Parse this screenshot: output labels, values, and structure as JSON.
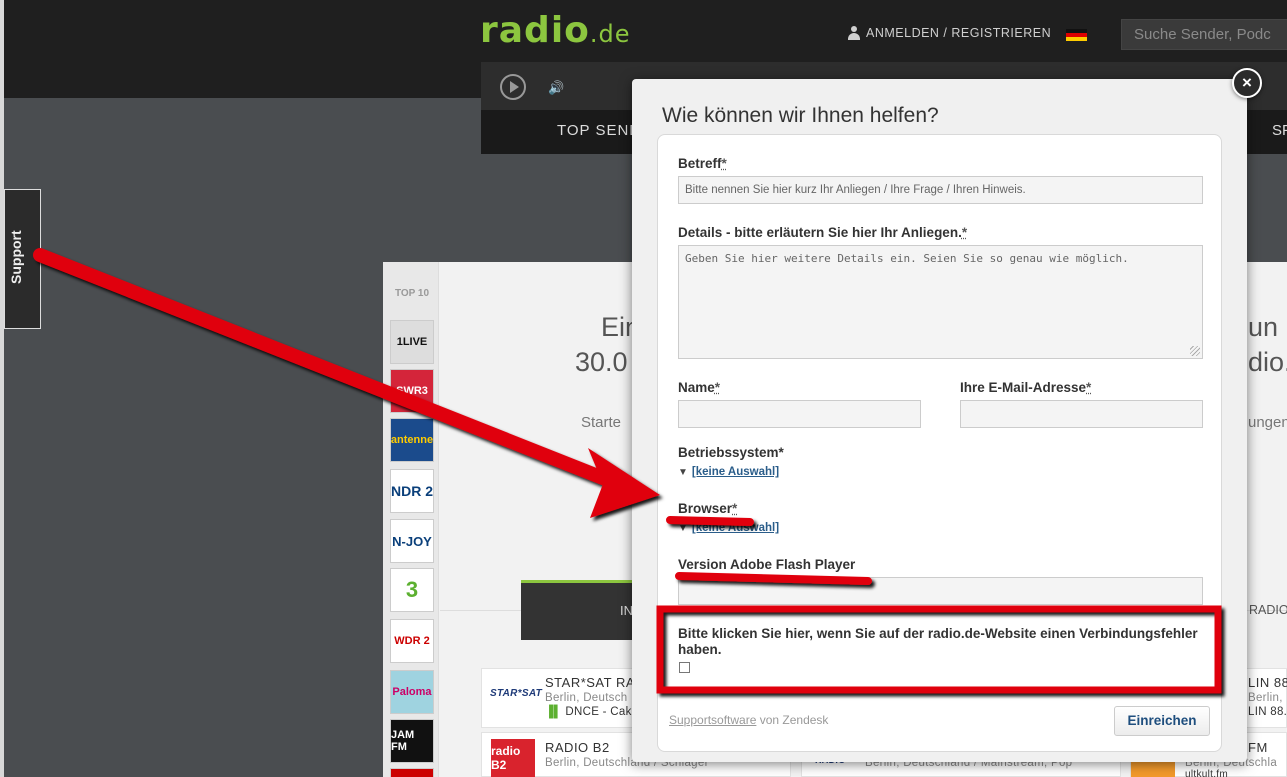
{
  "site": {
    "logo_main": "radio",
    "logo_tld": ".de",
    "login_label": "ANMELDEN / REGISTRIEREN",
    "search_placeholder": "Suche Sender, Podc",
    "nav_top": "TOP SENDE",
    "nav_right": "SP",
    "support_tab": "Support",
    "hero_left_1": "Ein",
    "hero_left_2": "30.0",
    "hero_right_1": "un",
    "hero_right_2": "dio.",
    "start_left": "Starte",
    "start_right": "ungen",
    "dark_button_text": "IN",
    "radio_right_text": "RADIO.",
    "top10_label": "TOP 10",
    "stations": [
      "1LIVE",
      "SWR3",
      "antenne",
      "NDR 2",
      "N-JOY",
      "3",
      "WDR 2",
      "Paloma",
      "JAM FM",
      ""
    ],
    "cards": [
      {
        "title": "STAR*SAT RADI",
        "sub": "Berlin, Deutsch",
        "now": "DNCE - Cake",
        "logo": "STAR*SAT"
      },
      {
        "title": "RADIO B2",
        "sub": "Berlin, Deutschland / Schlager",
        "logo": "radio B2"
      },
      {
        "title": "",
        "sub": "Berlin, Deutschland / Mainstream, Pop",
        "logo": "RADIO"
      },
      {
        "title": "LIN 88,",
        "sub": "Berlin, Deutschla",
        "now": "LIN 88.",
        "logo": ""
      },
      {
        "title": "FM",
        "sub": "Berlin, Deutschla",
        "now": "ultkult.fm",
        "logo": "kult"
      }
    ],
    "colors": {
      "brand_green": "#8cc63f",
      "annotation_red": "#e0000f"
    }
  },
  "modal": {
    "title": "Wie können wir Ihnen helfen?",
    "close_symbol": "×",
    "subject_label": "Betreff",
    "subject_placeholder": "Bitte nennen Sie hier kurz Ihr Anliegen / Ihre Frage / Ihren Hinweis.",
    "details_label": "Details - bitte erläutern Sie hier Ihr Anliegen.",
    "details_placeholder": "Geben Sie hier weitere Details ein. Seien Sie so genau wie möglich.",
    "name_label": "Name",
    "email_label": "Ihre E-Mail-Adresse",
    "os_label": "Betriebssystem*",
    "os_value": "[keine Auswahl]",
    "browser_label": "Browser",
    "browser_value": "[keine Auswahl]",
    "flash_label": "Version Adobe Flash Player",
    "connection_text": "Bitte klicken Sie hier, wenn Sie auf der radio.de-Website einen Verbindungsfehler haben.",
    "required_marker": "*",
    "footer_link": "Supportsoftware",
    "footer_suffix": " von Zendesk",
    "submit_label": "Einreichen"
  }
}
